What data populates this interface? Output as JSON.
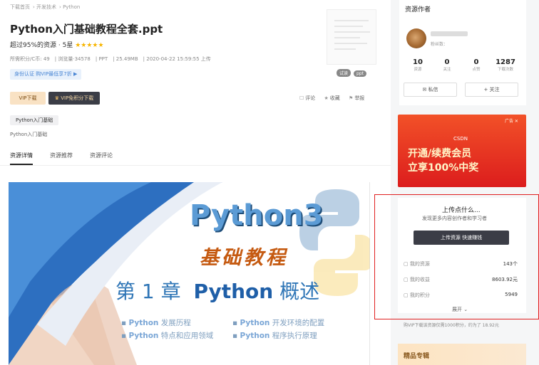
{
  "breadcrumb": [
    "下载首页",
    "开发技术",
    "Python"
  ],
  "resource": {
    "title": "Python入门基础教程全套.ppt",
    "rating_text": "超过95%的资源 · 5星",
    "stars": "★★★★★",
    "meta": [
      "所需积分/C币: 49",
      "浏览量·34578",
      "PPT",
      "25.49MB",
      "2020-04-22 15:59:55 上传"
    ],
    "vip_badge": "身份认证 购VIP最低享7折 ▶",
    "thumb_tags": [
      "试读",
      "ppt"
    ],
    "btn_vip_download": "VIP下载",
    "btn_vip_only": "VIP免积分下载",
    "actions": [
      {
        "icon": "comment-icon",
        "glyph": "☐",
        "label": "评论"
      },
      {
        "icon": "star-icon",
        "glyph": "★",
        "label": "收藏"
      },
      {
        "icon": "flag-icon",
        "glyph": "⚑",
        "label": "举报"
      }
    ],
    "category_tag": "Python入门基础",
    "description": "Python入门基础"
  },
  "tabs": [
    {
      "label": "资源详情",
      "active": true
    },
    {
      "label": "资源推荐",
      "active": false
    },
    {
      "label": "资源评论",
      "active": false
    }
  ],
  "slide": {
    "heading": "Python3",
    "subheading": "基础教程",
    "chapter_prefix": "第 1 章",
    "chapter_bold": "Python",
    "chapter_suffix": "概述",
    "bullets": [
      {
        "bold": "Python",
        "rest": " 发展历程"
      },
      {
        "bold": "Python",
        "rest": " 开发环境的配置"
      },
      {
        "bold": "Python",
        "rest": " 特点和应用领域"
      },
      {
        "bold": "Python",
        "rest": " 程序执行原理"
      }
    ]
  },
  "author": {
    "section_title": "资源作者",
    "fans_label": "粉丝数：",
    "stats": [
      {
        "n": "10",
        "l": "资源"
      },
      {
        "n": "0",
        "l": "关注"
      },
      {
        "n": "0",
        "l": "点赞"
      },
      {
        "n": "1287",
        "l": "下载次数"
      }
    ],
    "btn_message": "✉ 私信",
    "btn_follow": "+ 关注"
  },
  "banner": {
    "brand": "CSDN",
    "line1": "开通/续费会员",
    "line2": "立享100%中奖",
    "close": "广告 ✕"
  },
  "upload": {
    "title": "上传点什么...",
    "subtitle": "发现更多内容创作者和学习者",
    "button": "上传资源 快速赚钱",
    "rows": [
      {
        "icon": "folder-icon",
        "label": "我的资源",
        "value": "143个"
      },
      {
        "icon": "coin-icon",
        "label": "我的收益",
        "value": "8603.92元"
      },
      {
        "icon": "points-icon",
        "label": "我的积分",
        "value": "5949"
      }
    ],
    "expand": "展开 ⌄"
  },
  "vip_note": "购VIP下载该资源仅需1000积分，约为了 18.92元",
  "vip_note_price": "18.92元",
  "featured": "精品专辑"
}
